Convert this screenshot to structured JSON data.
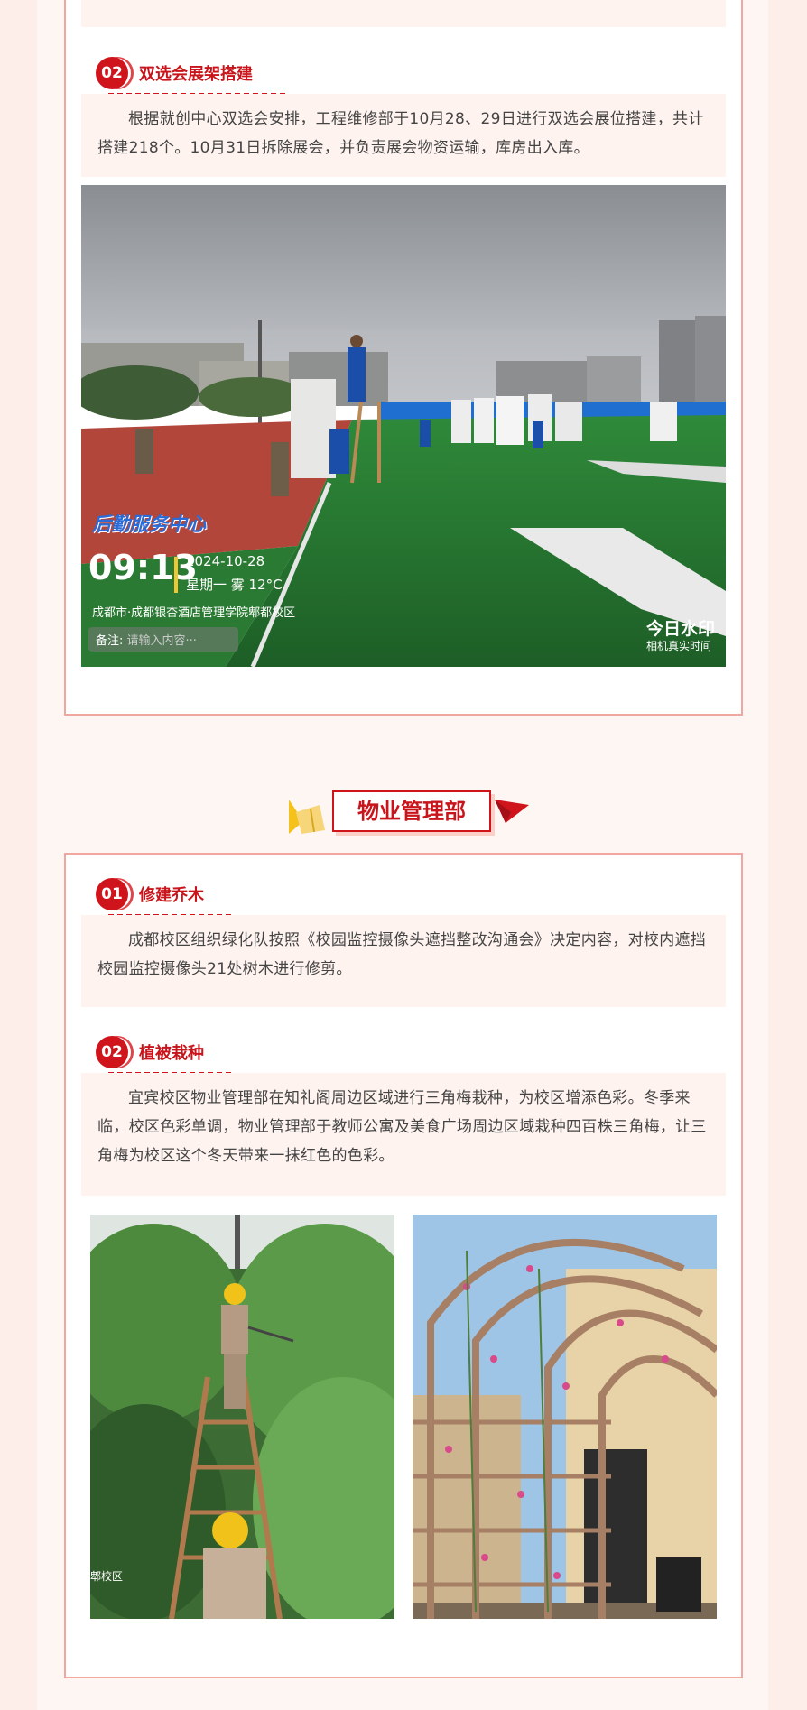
{
  "section1": {
    "item2": {
      "number": "02",
      "title": "双选会展架搭建",
      "text": "根据就创中心双选会安排，工程维修部于10月28、29日进行双选会展位搭建，共计搭建218个。10月31日拆除展会，并负责展会物资运输，库房出入库。"
    },
    "photo_watermark": {
      "brand": "后勤服务中心",
      "time": "09:13",
      "date": "2024-10-28",
      "weekday_weather": "星期一  雾 12°C",
      "location": "成都市·成都银杏酒店管理学院郫都校区",
      "remark_label": "备注:",
      "remark_placeholder": "请输入内容···",
      "stamp": "今日水印",
      "stamp_sub": "相机真实时间"
    }
  },
  "section2": {
    "banner_title": "物业管理部",
    "item1": {
      "number": "01",
      "title": "修建乔木",
      "text": "成都校区组织绿化队按照《校园监控摄像头遮挡整改沟通会》决定内容，对校内遮挡校园监控摄像头21处树木进行修剪。"
    },
    "item2": {
      "number": "02",
      "title": "植被栽种",
      "text": "宜宾校区物业管理部在知礼阁周边区域进行三角梅栽种，为校区增添色彩。冬季来临，校区色彩单调，物业管理部于教师公寓及美食广场周边区域栽种四百株三角梅，让三角梅为校区这个冬天带来一抹红色的色彩。"
    },
    "photo_caption": "郫校区"
  },
  "colors": {
    "accent": "#d0141c",
    "border": "#f0a7a0",
    "note_bg": "#fef3ef",
    "page_bg": "#fdeee9"
  }
}
